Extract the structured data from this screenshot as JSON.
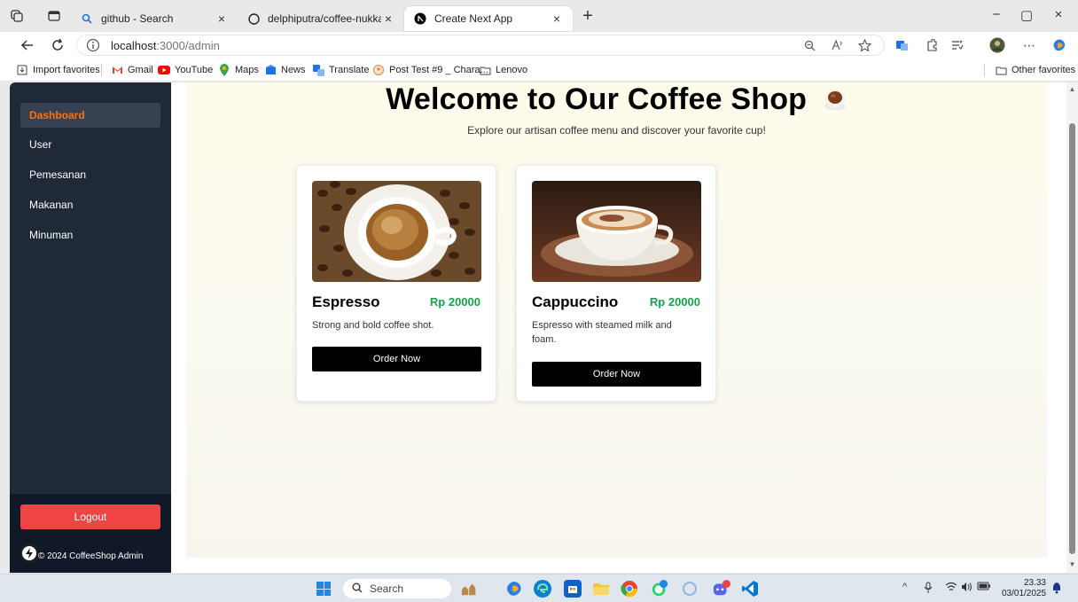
{
  "browser": {
    "tabs": [
      {
        "title": "github - Search",
        "close": "×"
      },
      {
        "title": "delphiputra/coffee-nukka",
        "close": "×"
      },
      {
        "title": "Create Next App",
        "close": "×"
      }
    ],
    "new_tab": "+",
    "window_controls": {
      "minimize": "−",
      "maximize": "▢",
      "close": "×"
    },
    "address": {
      "host": "localhost",
      "path": ":3000/admin"
    },
    "favorites": [
      {
        "label": "Import favorites",
        "icon": "import-icon"
      },
      {
        "label": "Gmail",
        "icon": "gmail-icon"
      },
      {
        "label": "YouTube",
        "icon": "youtube-icon"
      },
      {
        "label": "Maps",
        "icon": "maps-icon"
      },
      {
        "label": "News",
        "icon": "news-icon"
      },
      {
        "label": "Translate",
        "icon": "translate-icon"
      },
      {
        "label": "Post Test #9 _ Chara...",
        "icon": "web-icon"
      },
      {
        "label": "Lenovo",
        "icon": "folder-icon"
      }
    ],
    "other_favorites": "Other favorites"
  },
  "sidebar": {
    "items": [
      {
        "label": "Dashboard",
        "active": true
      },
      {
        "label": "User"
      },
      {
        "label": "Pemesanan"
      },
      {
        "label": "Makanan"
      },
      {
        "label": "Minuman"
      }
    ],
    "logout_label": "Logout",
    "copyright": "© 2024 CoffeeShop Admin"
  },
  "main": {
    "title": "Welcome to Our Coffee Shop",
    "subtitle": "Explore our artisan coffee menu and discover your favorite cup!",
    "products": [
      {
        "name": "Espresso",
        "price": "Rp 20000",
        "description": "Strong and bold coffee shot.",
        "button": "Order Now"
      },
      {
        "name": "Cappuccino",
        "price": "Rp 20000",
        "description": "Espresso with steamed milk and foam.",
        "button": "Order Now"
      }
    ]
  },
  "taskbar": {
    "search_placeholder": "Search",
    "time": "23.33",
    "date": "03/01/2025"
  },
  "colors": {
    "sidebar_bg": "#1f2937",
    "active_item": "#f97316",
    "logout": "#ef4444",
    "price": "#16a34a"
  }
}
